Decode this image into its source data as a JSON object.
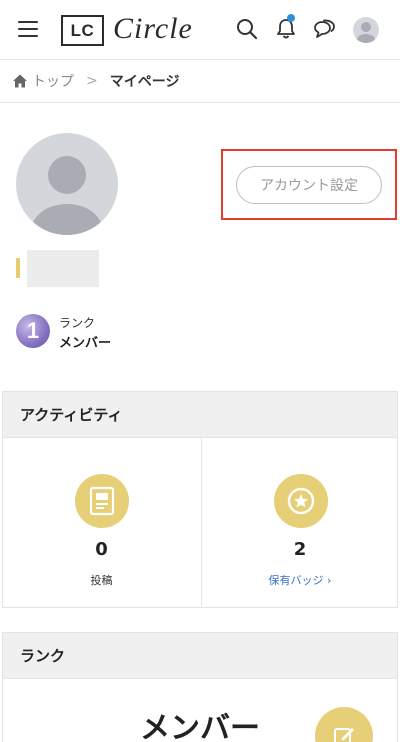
{
  "header": {
    "logo_box": "LC",
    "logo_script": "Circle",
    "icons": [
      "menu-icon",
      "search-icon",
      "bell-icon",
      "chat-icon",
      "avatar"
    ],
    "notification_dot_color": "#2f8fd8"
  },
  "breadcrumb": {
    "home": "トップ",
    "separator": ">",
    "current": "マイページ"
  },
  "profile": {
    "account_button": "アカウント設定",
    "rank_number": "1",
    "rank_label": "ランク",
    "rank_value": "メンバー"
  },
  "activity": {
    "title": "アクティビティ",
    "posts_count": "0",
    "posts_label": "投稿",
    "badges_count": "2",
    "badges_label": "保有バッジ ›"
  },
  "rank_section": {
    "title": "ランク",
    "rank_name": "メンバー"
  },
  "colors": {
    "accent_gold": "#e6cf76",
    "highlight_red": "#e03d2c",
    "link_blue": "#3a6fc4"
  }
}
